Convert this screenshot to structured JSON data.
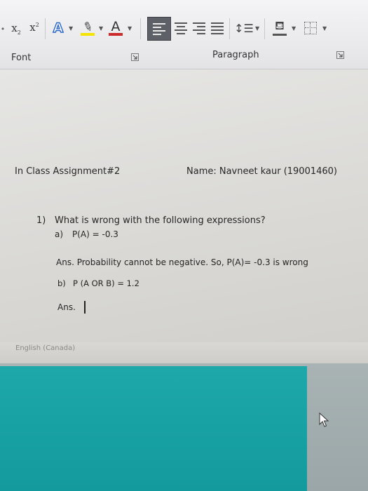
{
  "ribbon": {
    "font_group_label": "Font",
    "paragraph_group_label": "Paragraph",
    "subscript_label": "x",
    "subscript_mark": "2",
    "superscript_label": "x",
    "superscript_mark": "2",
    "text_effects_label": "A",
    "font_color_label": "A",
    "colors": {
      "font_color": "#cc2b2b",
      "highlight": "#f5e400",
      "text_effects": "#2a66c8"
    }
  },
  "document": {
    "heading_left": "In Class Assignment#2",
    "heading_right": "Name: Navneet kaur (19001460)",
    "question_number": "1)",
    "question_text": "What is wrong with the following expressions?",
    "item_a_label": "a)",
    "item_a_expr": "P(A) = -0.3",
    "item_a_answer": "Ans. Probability cannot be negative. So, P(A)= -0.3 is wrong",
    "item_b_label": "b)",
    "item_b_expr": "P (A OR B) = 1.2",
    "item_b_answer": "Ans."
  },
  "status_bar": {
    "language": "English (Canada)"
  }
}
